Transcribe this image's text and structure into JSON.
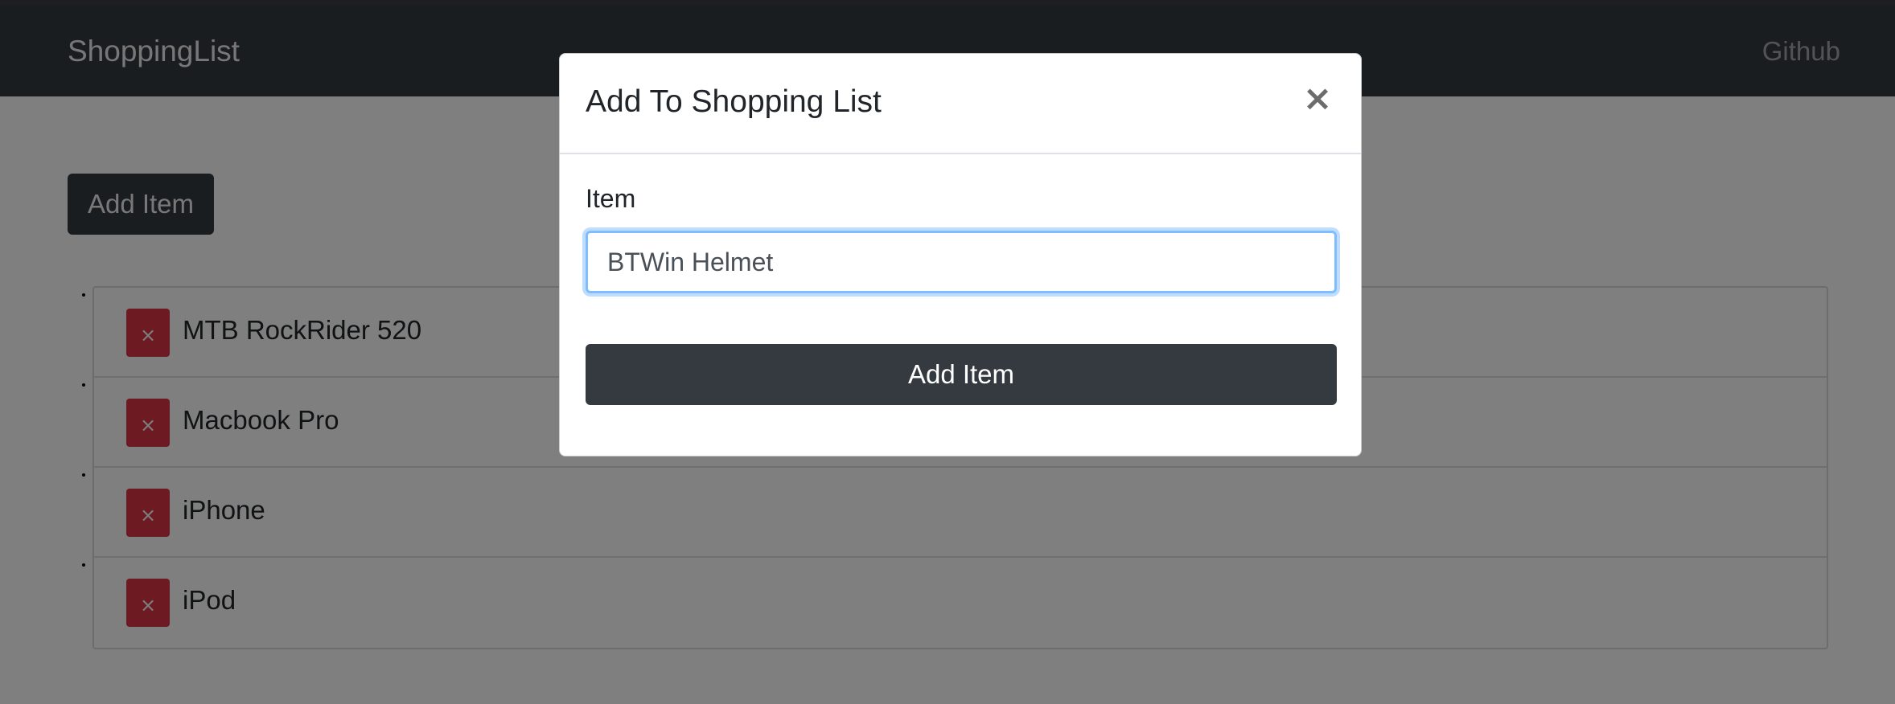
{
  "navbar": {
    "brand": "ShoppingList",
    "links": [
      {
        "label": "Github"
      }
    ]
  },
  "main": {
    "add_item_label": "Add Item",
    "items": [
      {
        "name": "MTB RockRider 520",
        "remove_label": "×"
      },
      {
        "name": "Macbook Pro",
        "remove_label": "×"
      },
      {
        "name": "iPhone",
        "remove_label": "×"
      },
      {
        "name": "iPod",
        "remove_label": "×"
      }
    ]
  },
  "modal": {
    "title": "Add To Shopping List",
    "close_label": "×",
    "field_label": "Item",
    "input_value": "BTWin Helmet",
    "submit_label": "Add Item"
  },
  "colors": {
    "navbar": "#343a40",
    "dark_button": "#343a40",
    "danger": "#dc3545",
    "focus_border": "#80bdff",
    "backdrop": "rgba(0,0,0,0.5)"
  },
  "icons": {
    "remove": "times-icon",
    "close": "close-icon"
  }
}
